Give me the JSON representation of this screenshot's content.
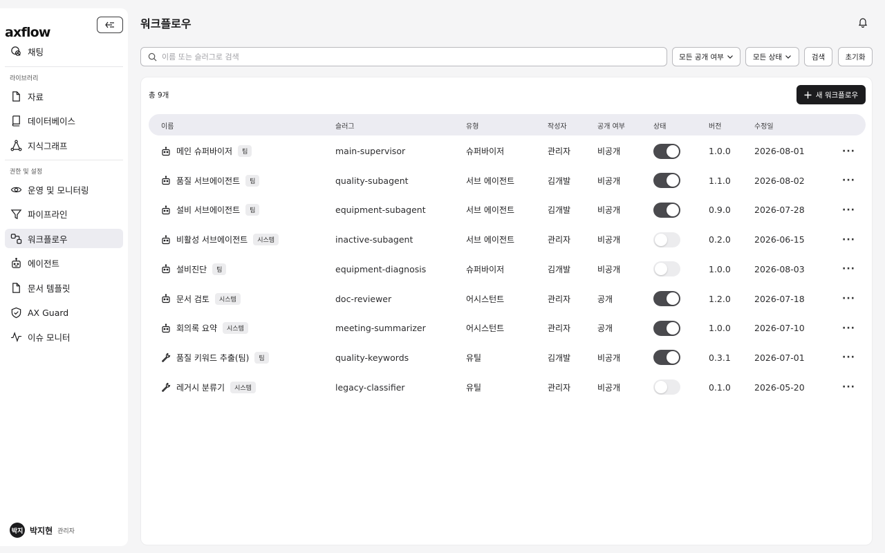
{
  "app": {
    "logo": "axflow"
  },
  "sidebar": {
    "chat": "채팅",
    "section_library": "라이브러리",
    "library_items": [
      "자료",
      "데이터베이스",
      "지식그래프"
    ],
    "section_settings": "권한 및 설정",
    "settings_items": [
      "운영 및 모니터링",
      "파이프라인",
      "워크플로우",
      "에이전트",
      "문서 템플릿",
      "AX Guard",
      "이슈 모니터"
    ],
    "active_item": "워크플로우"
  },
  "user": {
    "avatar": "박지",
    "name": "박지현",
    "role": "관리자"
  },
  "header": {
    "title": "워크플로우"
  },
  "toolbar": {
    "search_placeholder": "이름 또는 슬러그로 검색",
    "visibility_filter": "모든 공개 여부",
    "status_filter": "모든 상태",
    "search_button": "검색",
    "reset_button": "초기화"
  },
  "list": {
    "total": "총 9개",
    "new_button": "새 워크플로우",
    "columns": [
      "이름",
      "슬러그",
      "유형",
      "작성자",
      "공개 여부",
      "상태",
      "버전",
      "수정일"
    ],
    "rows": [
      {
        "icon": "robot-icon",
        "name": "메인 슈퍼바이저",
        "tag": "팀",
        "slug": "main-supervisor",
        "type": "슈퍼바이저",
        "author": "관리자",
        "visibility": "비공개",
        "active": true,
        "version": "1.0.0",
        "updated": "2026-08-01"
      },
      {
        "icon": "robot-icon",
        "name": "품질 서브에이전트",
        "tag": "팀",
        "slug": "quality-subagent",
        "type": "서브 에이전트",
        "author": "김개발",
        "visibility": "비공개",
        "active": true,
        "version": "1.1.0",
        "updated": "2026-08-02"
      },
      {
        "icon": "robot-icon",
        "name": "설비 서브에이전트",
        "tag": "팀",
        "slug": "equipment-subagent",
        "type": "서브 에이전트",
        "author": "김개발",
        "visibility": "비공개",
        "active": true,
        "version": "0.9.0",
        "updated": "2026-07-28"
      },
      {
        "icon": "robot-icon",
        "name": "비활성 서브에이전트",
        "tag": "시스템",
        "slug": "inactive-subagent",
        "type": "서브 에이전트",
        "author": "관리자",
        "visibility": "비공개",
        "active": false,
        "version": "0.2.0",
        "updated": "2026-06-15"
      },
      {
        "icon": "robot-icon",
        "name": "설비진단",
        "tag": "팀",
        "slug": "equipment-diagnosis",
        "type": "슈퍼바이저",
        "author": "김개발",
        "visibility": "비공개",
        "active": false,
        "version": "1.0.0",
        "updated": "2026-08-03"
      },
      {
        "icon": "robot-icon",
        "name": "문서 검토",
        "tag": "시스템",
        "slug": "doc-reviewer",
        "type": "어시스턴트",
        "author": "관리자",
        "visibility": "공개",
        "active": true,
        "version": "1.2.0",
        "updated": "2026-07-18"
      },
      {
        "icon": "robot-icon",
        "name": "회의록 요약",
        "tag": "시스템",
        "slug": "meeting-summarizer",
        "type": "어시스턴트",
        "author": "관리자",
        "visibility": "공개",
        "active": true,
        "version": "1.0.0",
        "updated": "2026-07-10"
      },
      {
        "icon": "wrench-icon",
        "name": "품질 키워드 추출(팀)",
        "tag": "팀",
        "slug": "quality-keywords",
        "type": "유틸",
        "author": "김개발",
        "visibility": "비공개",
        "active": true,
        "version": "0.3.1",
        "updated": "2026-07-01"
      },
      {
        "icon": "wrench-icon",
        "name": "레거시 분류기",
        "tag": "시스템",
        "slug": "legacy-classifier",
        "type": "유틸",
        "author": "관리자",
        "visibility": "비공개",
        "active": false,
        "version": "0.1.0",
        "updated": "2026-05-20"
      }
    ],
    "more_label": "···"
  }
}
